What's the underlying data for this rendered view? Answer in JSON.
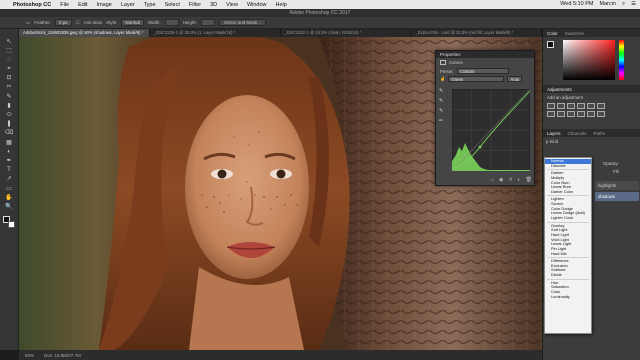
{
  "menubar": {
    "apple": "",
    "app": "Photoshop CC",
    "items": [
      "File",
      "Edit",
      "Image",
      "Layer",
      "Type",
      "Select",
      "Filter",
      "3D",
      "View",
      "Window",
      "Help"
    ],
    "clock": "Wed 5:10 PM",
    "user": "Marcin"
  },
  "window_title": "Adobe Photoshop CC 2017",
  "options": {
    "feather_label": "Feather:",
    "feather_value": "0 px",
    "antialias_label": "Anti-alias",
    "style_label": "Style:",
    "style_value": "Normal",
    "width_label": "Width:",
    "height_label": "Height:",
    "select_mask": "Select and Mask..."
  },
  "tabs": [
    "AdobeStock_118602636.jpeg @ 50% (shadows, Layer Mask/8) *",
    "_DSC2226-1 @ 33.3% (1, Layer Mask/16) *",
    "_DSC2342-1 @ 24.2% (clean, RGB/16) *",
    "_DLBA4746 - Lind @ 33.3% (red fill, Layer Mask/8) *"
  ],
  "tools": [
    "↖",
    "⬚",
    "◌",
    "⌖",
    "⊡",
    "✂",
    "✎",
    "▮",
    "⬭",
    "❚",
    "⌫",
    "▦",
    "◐",
    "✒",
    "T",
    "↗",
    "▭",
    "✋",
    "🔍"
  ],
  "status": {
    "zoom": "50%",
    "doc": "Doc: 19.9M/37.7M"
  },
  "properties": {
    "panel_title": "Properties",
    "subtitle": "Curves",
    "preset_label": "Preset:",
    "preset_value": "Custom",
    "channel_value": "Green",
    "auto_button": "Auto"
  },
  "right_panels": {
    "color_tab": "Color",
    "swatches_tab": "Swatches",
    "adjustments_tab": "Adjustments",
    "add_adjustment": "Add an adjustment",
    "layers_tab": "Layers",
    "channels_tab": "Channels",
    "paths_tab": "Paths",
    "kind_label": "p Kind",
    "opacity_label": "Opacity:",
    "fill_label": "Fill:",
    "highlights_layer": "highlights",
    "shadows_layer": "shadows"
  },
  "blend_menu": {
    "groups": [
      [
        "Normal",
        "Dissolve"
      ],
      [
        "Darken",
        "Multiply",
        "Color Burn",
        "Linear Burn",
        "Darker Color"
      ],
      [
        "Lighten",
        "Screen",
        "Color Dodge",
        "Linear Dodge (Add)",
        "Lighter Color"
      ],
      [
        "Overlay",
        "Soft Light",
        "Hard Light",
        "Vivid Light",
        "Linear Light",
        "Pin Light",
        "Hard Mix"
      ],
      [
        "Difference",
        "Exclusion",
        "Subtract",
        "Divide"
      ],
      [
        "Hue",
        "Saturation",
        "Color",
        "Luminosity"
      ]
    ],
    "selected": "Normal"
  },
  "colors": {
    "accent": "#3b78d8",
    "curve_green": "#7bd35a"
  }
}
